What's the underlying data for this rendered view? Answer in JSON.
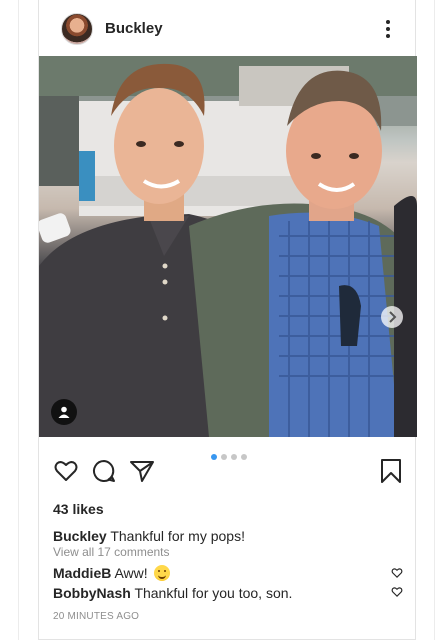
{
  "post": {
    "username": "Buckley",
    "likes": "43 likes",
    "caption": {
      "user": "Buckley",
      "text": "Thankful for my pops!"
    },
    "view_all": "View all 17 comments",
    "comments": [
      {
        "user": "MaddieB",
        "text": "Aww!"
      },
      {
        "user": "BobbyNash",
        "text": "Thankful for you too, son."
      }
    ],
    "time": "20 MINUTES AGO",
    "carousel": {
      "count": 4,
      "active": 1
    }
  },
  "colors": {
    "accent": "#3897f0",
    "muted": "#8e8e8e",
    "text": "#262626"
  },
  "icons": [
    "more-vertical-icon",
    "chevron-right-icon",
    "user-tag-icon",
    "heart-icon",
    "comment-icon",
    "share-icon",
    "bookmark-icon",
    "smile-emoji-icon"
  ]
}
